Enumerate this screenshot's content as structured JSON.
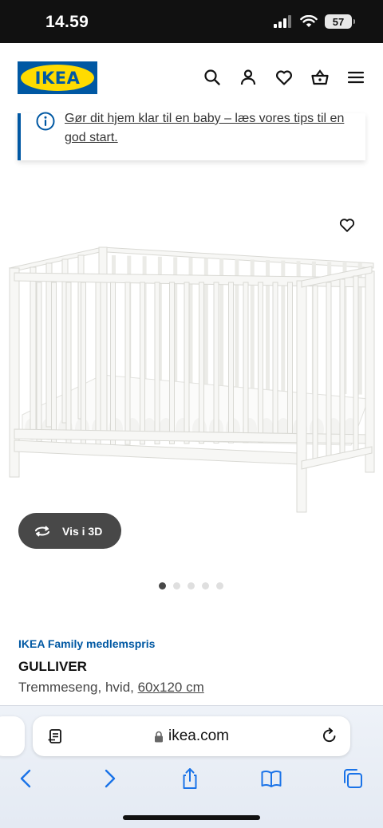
{
  "status": {
    "time": "14.59",
    "battery": "57"
  },
  "header": {
    "logo_text": "IKEA",
    "icons": [
      "search-icon",
      "user-icon",
      "heart-icon",
      "basket-icon",
      "menu-icon"
    ]
  },
  "banner": {
    "text": "Gør dit hjem klar til en baby – læs vores tips til en god start.",
    "icon": "info-icon"
  },
  "product": {
    "view_3d_label": "Vis i 3D",
    "image_count": 5,
    "active_image": 1,
    "family_price_label": "IKEA Family medlemspris",
    "name": "GULLIVER",
    "description_prefix": "Tremmeseng, hvid, ",
    "size": "60x120 cm"
  },
  "browser": {
    "url": "ikea.com"
  },
  "colors": {
    "ikea_blue": "#0058a3",
    "ikea_yellow": "#ffdb00",
    "dark_button": "#484848"
  }
}
